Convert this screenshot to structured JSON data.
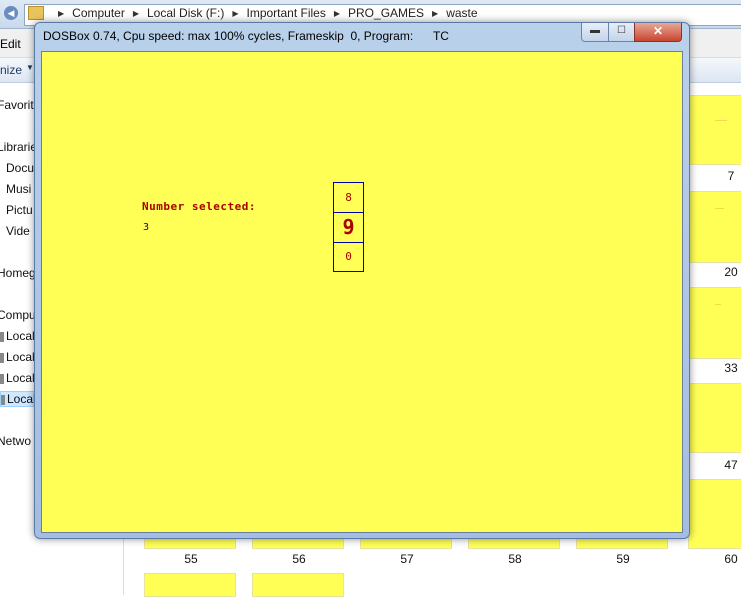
{
  "explorer": {
    "breadcrumb": [
      "Computer",
      "Local Disk (F:)",
      "Important Files",
      "PRO_GAMES",
      "waste"
    ],
    "menu_edit": "Edit",
    "organize": "nize",
    "nav": {
      "favorites": "Favorite",
      "libraries": "Librarie",
      "documents": "Docu",
      "music": "Musi",
      "pictures": "Pictu",
      "videos": "Vide",
      "homegroup": "Homeg",
      "computer": "Compu",
      "local1": "Local",
      "local2": "Local",
      "local3": "Local",
      "local4": "Local",
      "network": "Netwo"
    },
    "thumb_labels": {
      "r7": "7",
      "r20": "20",
      "r33": "33",
      "r47": "47",
      "b55": "55",
      "b56": "56",
      "b57": "57",
      "b58": "58",
      "b59": "59",
      "b60": "60"
    }
  },
  "dosbox": {
    "title": "DOSBox 0.74, Cpu speed: max 100% cycles, Frameskip  0, Program:      TC",
    "min_label": "▬",
    "max_label": "☐",
    "close_label": "✕",
    "screen": {
      "number_label": "Number selected:",
      "number_value": "3",
      "spinner_above": "8",
      "spinner_current": "9",
      "spinner_below": "0"
    },
    "colors": {
      "screen_bg": "#ffff55",
      "label_text": "#aa0000",
      "value_text": "#0000aa"
    }
  }
}
